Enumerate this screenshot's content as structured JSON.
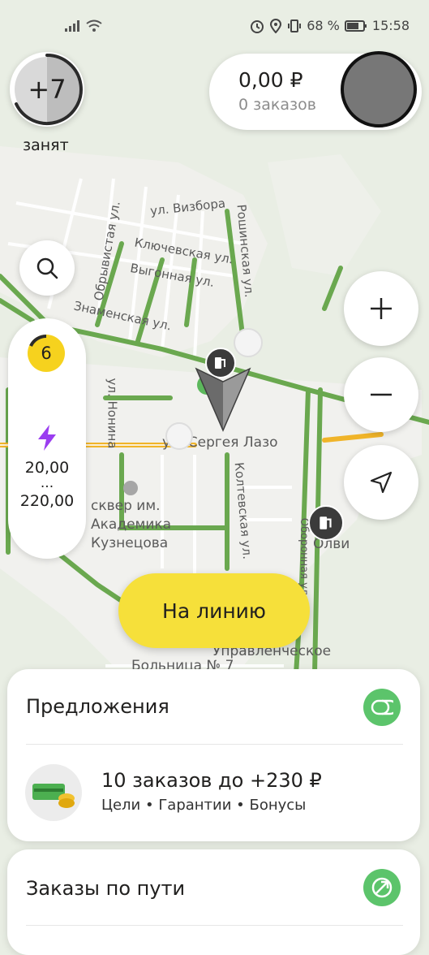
{
  "status_bar": {
    "battery": "68 %",
    "time": "15:58"
  },
  "top": {
    "level_badge": "+7",
    "driver_status": "занят",
    "balance": "0,00 ₽",
    "orders_count": "0 заказов"
  },
  "left_panel": {
    "priority_count": "6",
    "surge_min": "20,00",
    "surge_ellipsis": "...",
    "surge_max": "220,00"
  },
  "map_labels": {
    "streets": [
      "ул. Визбора",
      "Ключевская ул.",
      "Выгонная ул.",
      "Знаменская ул.",
      "Обрывистая ул.",
      "Рошинская ул.",
      "ул. Нонина",
      "ул. Сергея Лазо",
      "Колтевская ул.",
      "Оборонная ул."
    ],
    "park": "сквер им. Академика Кузнецова",
    "place_olvi": "Олви",
    "upravlencheskoe": "Управленческое",
    "bolnitsa": "Больница № 7"
  },
  "go_online_button": "На линию",
  "offers_card": {
    "title": "Предложения",
    "promo_title": "10 заказов до +230 ₽",
    "promo_subtitle": "Цели • Гарантии • Бонусы"
  },
  "route_orders_card": {
    "title": "Заказы по пути"
  },
  "colors": {
    "accent_yellow": "#f6e03a",
    "road_green": "#6aa84f",
    "road_yellow": "#f0b429",
    "surge_purple": "#9a3df0"
  }
}
